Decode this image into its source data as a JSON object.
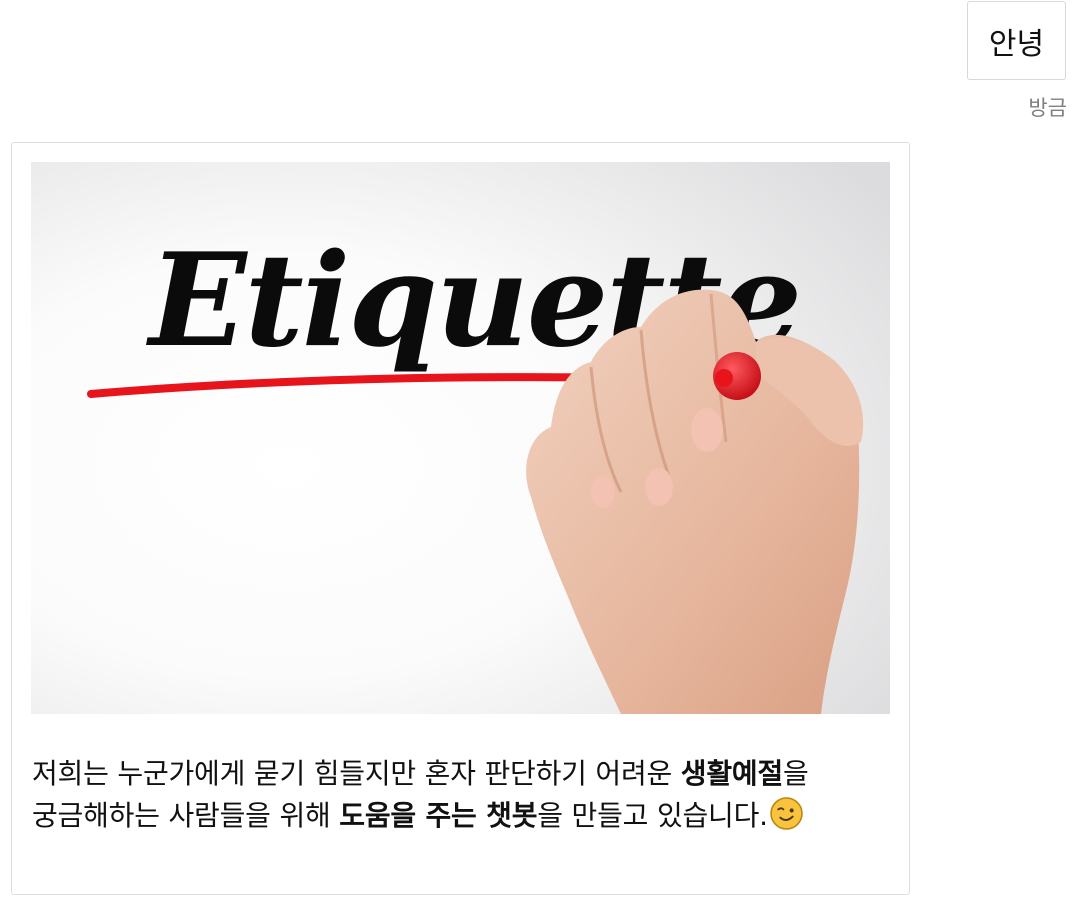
{
  "user_message": {
    "text": "안녕",
    "timestamp": "방금"
  },
  "bot_message": {
    "image": {
      "handwritten_word": "Etiquette",
      "subject": "hand writing with red marker",
      "marker_color": "#e8141b"
    },
    "text_parts": [
      {
        "text": "저희는 누군가에게 묻기 힘들지만 혼자 판단하기 어려운 ",
        "bold": false
      },
      {
        "text": "생활예절",
        "bold": true
      },
      {
        "text": "을 궁금해하는 사람들을 위해 ",
        "bold": false
      },
      {
        "text": "도움을 주는 챗봇",
        "bold": true
      },
      {
        "text": "을 만들고 있습니다.",
        "bold": false
      }
    ],
    "emoji": "winking-face"
  },
  "colors": {
    "bubble_border": "#d9d9d9",
    "timestamp": "#808080",
    "text": "#111111"
  }
}
